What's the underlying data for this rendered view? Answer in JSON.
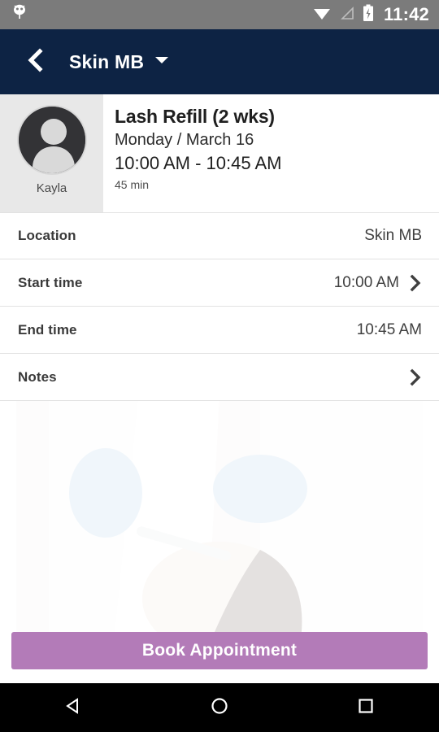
{
  "status_bar": {
    "notification_icon": "android-head-icon",
    "wifi_icon": "wifi-icon",
    "signal_icon": "cell-signal-icon",
    "battery_icon": "battery-charging-icon",
    "time": "11:42",
    "background_color": "#7b7b7b"
  },
  "app_bar": {
    "back_icon": "back-chevron-icon",
    "title": "Skin MB",
    "dropdown_icon": "chevron-down-icon",
    "background_color": "#0d2344"
  },
  "appointment": {
    "avatar_icon": "person-avatar-icon",
    "staff_name": "Kayla",
    "service": "Lash Refill (2 wks)",
    "date": "Monday / March 16",
    "time_range": "10:00 AM - 10:45 AM",
    "duration": "45 min"
  },
  "details": [
    {
      "label": "Location",
      "value": "Skin MB",
      "chevron": false,
      "name": "location"
    },
    {
      "label": "Start time",
      "value": "10:00 AM",
      "chevron": true,
      "name": "start-time"
    },
    {
      "label": "End time",
      "value": "10:45 AM",
      "chevron": false,
      "name": "end-time"
    },
    {
      "label": "Notes",
      "value": "",
      "chevron": true,
      "name": "notes"
    }
  ],
  "footer": {
    "book_label": "Book Appointment",
    "book_color": "#b37bb8"
  },
  "nav_bar": {
    "back_icon": "nav-back-triangle-icon",
    "home_icon": "nav-home-circle-icon",
    "recents_icon": "nav-recents-square-icon"
  }
}
